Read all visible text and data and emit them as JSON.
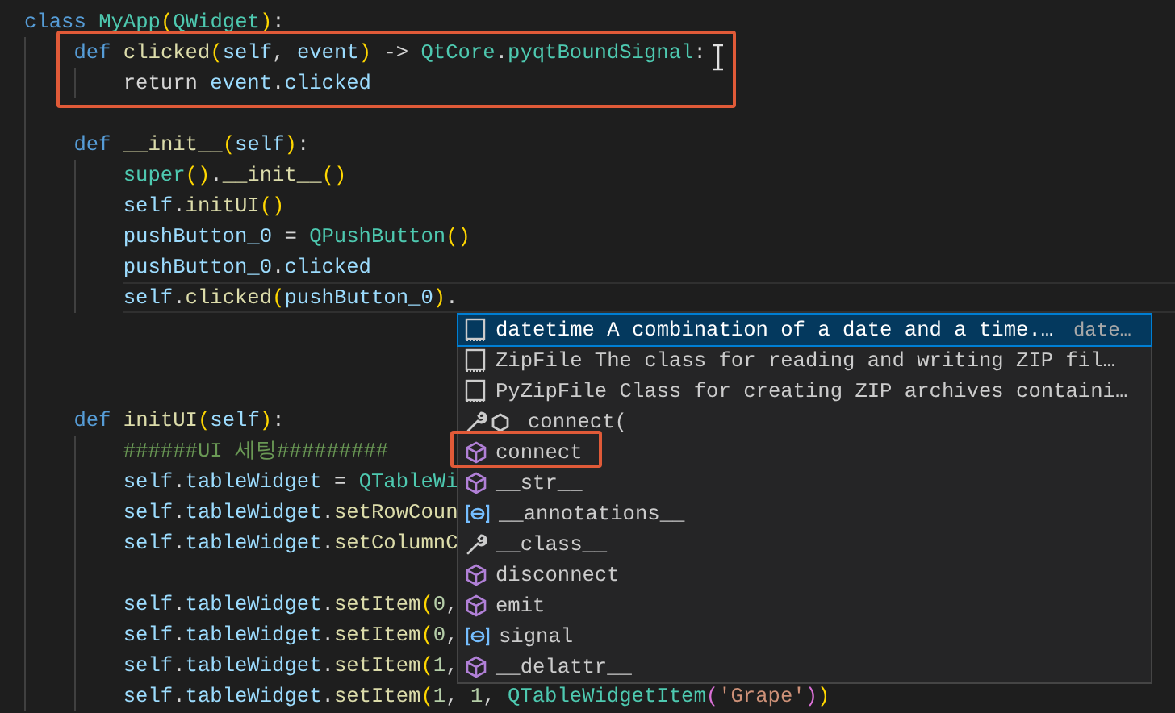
{
  "code": [
    {
      "kind": "code",
      "current": false,
      "tokens": [
        {
          "text": "class ",
          "kind": "kw"
        },
        {
          "text": "MyApp",
          "kind": "cls"
        },
        {
          "text": "(",
          "kind": "p1"
        },
        {
          "text": "QWidget",
          "kind": "cls"
        },
        {
          "text": ")",
          "kind": "p1"
        },
        {
          "text": ":",
          "kind": "op"
        }
      ],
      "children": [
        {
          "kind": "code",
          "current": false,
          "tokens": [
            {
              "text": "def ",
              "kind": "kw"
            },
            {
              "text": "clicked",
              "kind": "fn"
            },
            {
              "text": "(",
              "kind": "p1"
            },
            {
              "text": "self",
              "kind": "var"
            },
            {
              "text": ", ",
              "kind": "op"
            },
            {
              "text": "event",
              "kind": "var"
            },
            {
              "text": ")",
              "kind": "p1"
            },
            {
              "text": " -> ",
              "kind": "op"
            },
            {
              "text": "QtCore",
              "kind": "cls"
            },
            {
              "text": ".",
              "kind": "op"
            },
            {
              "text": "pyqtBoundSignal",
              "kind": "cls"
            },
            {
              "text": ":",
              "kind": "op"
            }
          ],
          "children": [
            {
              "kind": "code",
              "current": false,
              "tokens": [
                {
                  "text": "return ",
                  "kind": "op"
                },
                {
                  "text": "event",
                  "kind": "var"
                },
                {
                  "text": ".",
                  "kind": "op"
                },
                {
                  "text": "clicked",
                  "kind": "var"
                }
              ]
            }
          ]
        },
        {
          "kind": "blank"
        },
        {
          "kind": "code",
          "current": false,
          "tokens": [
            {
              "text": "def ",
              "kind": "kw"
            },
            {
              "text": "__init__",
              "kind": "fn"
            },
            {
              "text": "(",
              "kind": "p1"
            },
            {
              "text": "self",
              "kind": "var"
            },
            {
              "text": ")",
              "kind": "p1"
            },
            {
              "text": ":",
              "kind": "op"
            }
          ],
          "children": [
            {
              "kind": "code",
              "current": false,
              "tokens": [
                {
                  "text": "super",
                  "kind": "cls"
                },
                {
                  "text": "()",
                  "kind": "p1"
                },
                {
                  "text": ".",
                  "kind": "op"
                },
                {
                  "text": "__init__",
                  "kind": "fn"
                },
                {
                  "text": "()",
                  "kind": "p1"
                }
              ]
            },
            {
              "kind": "code",
              "current": false,
              "tokens": [
                {
                  "text": "self",
                  "kind": "var"
                },
                {
                  "text": ".",
                  "kind": "op"
                },
                {
                  "text": "initUI",
                  "kind": "fn"
                },
                {
                  "text": "()",
                  "kind": "p1"
                }
              ]
            },
            {
              "kind": "code",
              "current": false,
              "tokens": [
                {
                  "text": "pushButton_0",
                  "kind": "var"
                },
                {
                  "text": " = ",
                  "kind": "op"
                },
                {
                  "text": "QPushButton",
                  "kind": "cls"
                },
                {
                  "text": "()",
                  "kind": "p1"
                }
              ]
            },
            {
              "kind": "code",
              "current": false,
              "tokens": [
                {
                  "text": "pushButton_0",
                  "kind": "var"
                },
                {
                  "text": ".",
                  "kind": "op"
                },
                {
                  "text": "clicked",
                  "kind": "var"
                }
              ]
            },
            {
              "kind": "code",
              "current": true,
              "tokens": [
                {
                  "text": "self",
                  "kind": "var"
                },
                {
                  "text": ".",
                  "kind": "op"
                },
                {
                  "text": "clicked",
                  "kind": "fn"
                },
                {
                  "text": "(",
                  "kind": "p1"
                },
                {
                  "text": "pushButton_0",
                  "kind": "var"
                },
                {
                  "text": ")",
                  "kind": "p1"
                },
                {
                  "text": ".",
                  "kind": "op"
                }
              ]
            }
          ]
        },
        {
          "kind": "blank"
        },
        {
          "kind": "blank"
        },
        {
          "kind": "blank"
        },
        {
          "kind": "code",
          "current": false,
          "tokens": [
            {
              "text": "def ",
              "kind": "kw"
            },
            {
              "text": "initUI",
              "kind": "fn"
            },
            {
              "text": "(",
              "kind": "p1"
            },
            {
              "text": "self",
              "kind": "var"
            },
            {
              "text": ")",
              "kind": "p1"
            },
            {
              "text": ":",
              "kind": "op"
            }
          ],
          "children": [
            {
              "kind": "code",
              "current": false,
              "tokens": [
                {
                  "text": "######UI 세팅#########",
                  "kind": "cm"
                }
              ]
            },
            {
              "kind": "code",
              "current": false,
              "tokens": [
                {
                  "text": "self",
                  "kind": "var"
                },
                {
                  "text": ".",
                  "kind": "op"
                },
                {
                  "text": "tableWidget",
                  "kind": "var"
                },
                {
                  "text": " = ",
                  "kind": "op"
                },
                {
                  "text": "QTableWi",
                  "kind": "cls"
                }
              ]
            },
            {
              "kind": "code",
              "current": false,
              "tokens": [
                {
                  "text": "self",
                  "kind": "var"
                },
                {
                  "text": ".",
                  "kind": "op"
                },
                {
                  "text": "tableWidget",
                  "kind": "var"
                },
                {
                  "text": ".",
                  "kind": "op"
                },
                {
                  "text": "setRowCoun",
                  "kind": "fn"
                }
              ]
            },
            {
              "kind": "code",
              "current": false,
              "tokens": [
                {
                  "text": "self",
                  "kind": "var"
                },
                {
                  "text": ".",
                  "kind": "op"
                },
                {
                  "text": "tableWidget",
                  "kind": "var"
                },
                {
                  "text": ".",
                  "kind": "op"
                },
                {
                  "text": "setColumnC",
                  "kind": "fn"
                }
              ]
            },
            {
              "kind": "blank"
            },
            {
              "kind": "code",
              "current": false,
              "tokens": [
                {
                  "text": "self",
                  "kind": "var"
                },
                {
                  "text": ".",
                  "kind": "op"
                },
                {
                  "text": "tableWidget",
                  "kind": "var"
                },
                {
                  "text": ".",
                  "kind": "op"
                },
                {
                  "text": "setItem",
                  "kind": "fn"
                },
                {
                  "text": "(",
                  "kind": "p1"
                },
                {
                  "text": "0",
                  "kind": "num"
                },
                {
                  "text": ",",
                  "kind": "op"
                }
              ]
            },
            {
              "kind": "code",
              "current": false,
              "tokens": [
                {
                  "text": "self",
                  "kind": "var"
                },
                {
                  "text": ".",
                  "kind": "op"
                },
                {
                  "text": "tableWidget",
                  "kind": "var"
                },
                {
                  "text": ".",
                  "kind": "op"
                },
                {
                  "text": "setItem",
                  "kind": "fn"
                },
                {
                  "text": "(",
                  "kind": "p1"
                },
                {
                  "text": "0",
                  "kind": "num"
                },
                {
                  "text": ",",
                  "kind": "op"
                }
              ]
            },
            {
              "kind": "code",
              "current": false,
              "tokens": [
                {
                  "text": "self",
                  "kind": "var"
                },
                {
                  "text": ".",
                  "kind": "op"
                },
                {
                  "text": "tableWidget",
                  "kind": "var"
                },
                {
                  "text": ".",
                  "kind": "op"
                },
                {
                  "text": "setItem",
                  "kind": "fn"
                },
                {
                  "text": "(",
                  "kind": "p1"
                },
                {
                  "text": "1",
                  "kind": "num"
                },
                {
                  "text": ",",
                  "kind": "op"
                }
              ]
            },
            {
              "kind": "code",
              "current": false,
              "tokens": [
                {
                  "text": "self",
                  "kind": "var"
                },
                {
                  "text": ".",
                  "kind": "op"
                },
                {
                  "text": "tableWidget",
                  "kind": "var"
                },
                {
                  "text": ".",
                  "kind": "op"
                },
                {
                  "text": "setItem",
                  "kind": "fn"
                },
                {
                  "text": "(",
                  "kind": "p1"
                },
                {
                  "text": "1",
                  "kind": "num"
                },
                {
                  "text": ", ",
                  "kind": "op"
                },
                {
                  "text": "1",
                  "kind": "num"
                },
                {
                  "text": ", ",
                  "kind": "op"
                },
                {
                  "text": "QTableWidgetItem",
                  "kind": "cls"
                },
                {
                  "text": "(",
                  "kind": "p2"
                },
                {
                  "text": "'Grape'",
                  "kind": "str"
                },
                {
                  "text": ")",
                  "kind": "p2"
                },
                {
                  "text": ")",
                  "kind": "p1"
                }
              ]
            }
          ]
        }
      ]
    }
  ],
  "suggestions": [
    {
      "kind": "module",
      "label": "datetime A combination of a date and a time.…",
      "detail": "date…",
      "selected": true
    },
    {
      "kind": "module",
      "label": "ZipFile The class for reading and writing ZIP fil…",
      "selected": false
    },
    {
      "kind": "module",
      "label": "PyZipFile Class for creating ZIP archives containi…",
      "selected": false
    },
    {
      "kind": "snippet",
      "label": "connect(",
      "selected": false
    },
    {
      "kind": "method",
      "label": "connect",
      "selected": false
    },
    {
      "kind": "method",
      "label": "__str__",
      "selected": false
    },
    {
      "kind": "field",
      "label": "__annotations__",
      "selected": false
    },
    {
      "kind": "property",
      "label": "__class__",
      "selected": false
    },
    {
      "kind": "method",
      "label": "disconnect",
      "selected": false
    },
    {
      "kind": "method",
      "label": "emit",
      "selected": false
    },
    {
      "kind": "field",
      "label": "signal",
      "selected": false
    },
    {
      "kind": "method",
      "label": "__delattr__",
      "selected": false
    }
  ]
}
